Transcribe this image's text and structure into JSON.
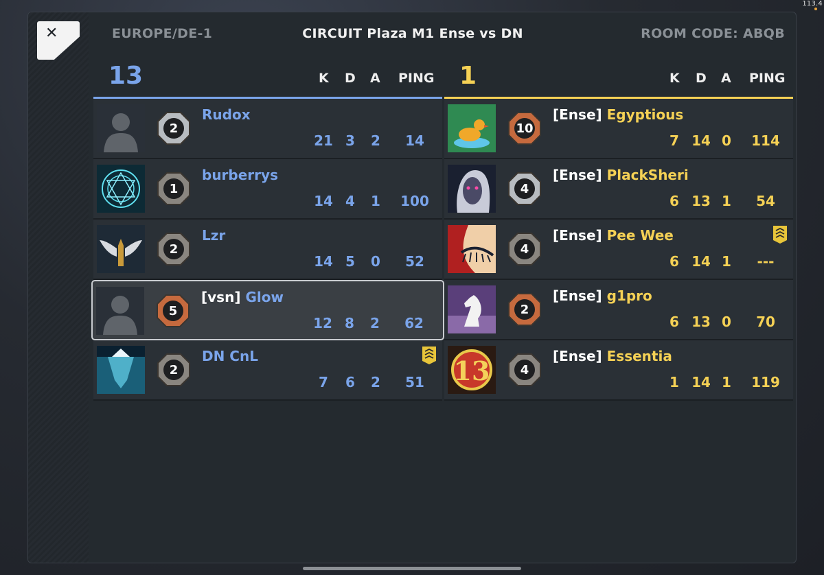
{
  "fps": "113.4",
  "header": {
    "close_label": "✕",
    "region": "EUROPE/DE-1",
    "title": "CIRCUIT Plaza M1 Ense vs DN",
    "room_code": "ROOM CODE: ABQB"
  },
  "columns": {
    "k": "K",
    "d": "D",
    "a": "A",
    "ping": "PING"
  },
  "colors": {
    "blue": "#7aa4ea",
    "yellow": "#f5d155",
    "bronze": "#c66a3e",
    "silver": "#b8bcc0",
    "iron": "#8a8680"
  },
  "blue_team": {
    "score": "13",
    "players": [
      {
        "tag": "",
        "name": "Rudox",
        "rank": "2",
        "rank_style": "silver",
        "avatar": "silhouette-avatar",
        "k": "21",
        "d": "3",
        "a": "2",
        "ping": "14",
        "badge": false,
        "selected": false
      },
      {
        "tag": "",
        "name": "burberrys",
        "rank": "1",
        "rank_style": "iron",
        "avatar": "magic-circle-avatar",
        "k": "14",
        "d": "4",
        "a": "1",
        "ping": "100",
        "badge": false,
        "selected": false
      },
      {
        "tag": "",
        "name": "Lzr",
        "rank": "2",
        "rank_style": "iron",
        "avatar": "winged-bullet-avatar",
        "k": "14",
        "d": "5",
        "a": "0",
        "ping": "52",
        "badge": false,
        "selected": false
      },
      {
        "tag": "[vsn] ",
        "name": "Glow",
        "rank": "5",
        "rank_style": "bronze",
        "avatar": "silhouette-avatar",
        "k": "12",
        "d": "8",
        "a": "2",
        "ping": "62",
        "badge": false,
        "selected": true
      },
      {
        "tag": "",
        "name": "DN CnL",
        "rank": "2",
        "rank_style": "iron",
        "avatar": "iceberg-avatar",
        "k": "7",
        "d": "6",
        "a": "2",
        "ping": "51",
        "badge": true,
        "selected": false
      }
    ]
  },
  "yellow_team": {
    "score": "1",
    "players": [
      {
        "tag": "[Ense] ",
        "name": "Egyptious",
        "rank": "10",
        "rank_style": "bronze",
        "avatar": "duck-avatar",
        "k": "7",
        "d": "14",
        "a": "0",
        "ping": "114",
        "badge": false,
        "selected": false
      },
      {
        "tag": "[Ense] ",
        "name": "PlackSheri",
        "rank": "4",
        "rank_style": "silver",
        "avatar": "dark-face-avatar",
        "k": "6",
        "d": "13",
        "a": "1",
        "ping": "54",
        "badge": false,
        "selected": false
      },
      {
        "tag": "[Ense] ",
        "name": "Pee Wee",
        "rank": "4",
        "rank_style": "iron",
        "avatar": "eyelash-avatar",
        "k": "6",
        "d": "14",
        "a": "1",
        "ping": "---",
        "badge": true,
        "selected": false
      },
      {
        "tag": "[Ense] ",
        "name": "g1pro",
        "rank": "2",
        "rank_style": "bronze",
        "avatar": "chess-knight-avatar",
        "k": "6",
        "d": "13",
        "a": "0",
        "ping": "70",
        "badge": false,
        "selected": false
      },
      {
        "tag": "[Ense] ",
        "name": "Essentia",
        "rank": "4",
        "rank_style": "iron",
        "avatar": "number-13-avatar",
        "k": "1",
        "d": "14",
        "a": "1",
        "ping": "119",
        "badge": false,
        "selected": false
      }
    ]
  }
}
